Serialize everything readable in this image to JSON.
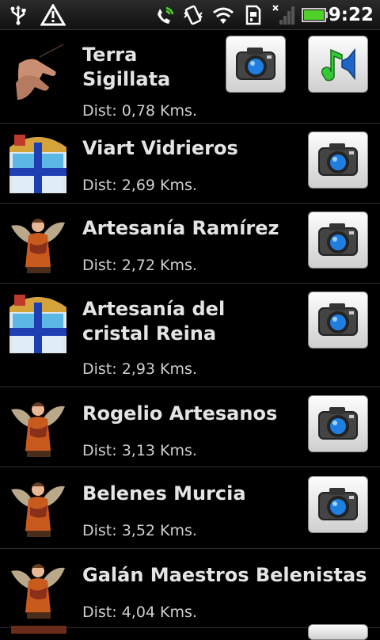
{
  "status_bar": {
    "time": "9:22",
    "icons": [
      "usb-icon",
      "warning-icon",
      "phone-signal-icon",
      "vibrate-icon",
      "wifi-icon",
      "sd-card-icon",
      "no-signal-icon",
      "battery-icon"
    ]
  },
  "colors": {
    "background": "#000000",
    "title": "#e4e4e4",
    "dist": "#cfcfcf",
    "battery": "#4fd12a",
    "camera_lens": "#1f7fe0"
  },
  "items": [
    {
      "title_line1": "Terra",
      "title_line2": "Sigillata",
      "dist": "Dist: 0,78 Kms.",
      "thumb": "hands-icon",
      "buttons": [
        "camera-icon",
        "audio-icon"
      ]
    },
    {
      "title_line1": "Viart Vidrieros",
      "title_line2": "",
      "dist": "Dist: 2,69 Kms.",
      "thumb": "stained-glass-icon",
      "buttons": [
        "camera-icon"
      ]
    },
    {
      "title_line1": "Artesanía Ramírez",
      "title_line2": "",
      "dist": "Dist: 2,72 Kms.",
      "thumb": "angel-figurine-icon",
      "buttons": [
        "camera-icon"
      ]
    },
    {
      "title_line1": "Artesanía del",
      "title_line2": "cristal Reina",
      "dist": "Dist: 2,93 Kms.",
      "thumb": "stained-glass-icon",
      "buttons": [
        "camera-icon"
      ]
    },
    {
      "title_line1": "Rogelio Artesanos",
      "title_line2": "",
      "dist": "Dist: 3,13 Kms.",
      "thumb": "angel-figurine-icon",
      "buttons": [
        "camera-icon"
      ]
    },
    {
      "title_line1": "Belenes Murcia",
      "title_line2": "",
      "dist": "Dist: 3,52 Kms.",
      "thumb": "angel-figurine-icon",
      "buttons": [
        "camera-icon"
      ]
    },
    {
      "title_line1": "Galán Maestros Belenistas",
      "title_line2": "",
      "dist": "Dist: 4,04 Kms.",
      "thumb": "angel-figurine-icon",
      "buttons": []
    }
  ]
}
